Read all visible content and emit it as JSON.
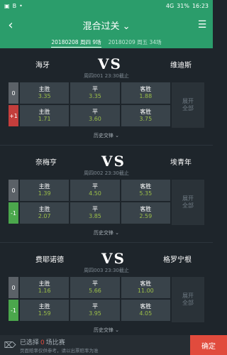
{
  "statusbar": {
    "left_icons": [
      "▣",
      "B",
      "•"
    ],
    "signal": "4G",
    "battery": "31%",
    "time": "16:23"
  },
  "header": {
    "back_icon": "‹",
    "title": "混合过关",
    "title_caret": "⌄",
    "menu_icon": "☰"
  },
  "datebar": {
    "active": "20180208 周四 9场",
    "next": "20180209 周五 34场"
  },
  "matches": [
    {
      "home": "海牙",
      "vs": "VS",
      "away": "维迪斯",
      "meta": "周四001   23:30截止",
      "rows": [
        {
          "hc": "0",
          "hc_type": "zero",
          "odds": [
            {
              "l": "主胜",
              "v": "3.35"
            },
            {
              "l": "平",
              "v": "3.35"
            },
            {
              "l": "客胜",
              "v": "1.88"
            }
          ]
        },
        {
          "hc": "+1",
          "hc_type": "pos",
          "odds": [
            {
              "l": "主胜",
              "v": "1.71"
            },
            {
              "l": "平",
              "v": "3.60"
            },
            {
              "l": "客胜",
              "v": "3.75"
            }
          ]
        }
      ],
      "expand_1": "展开",
      "expand_2": "全部",
      "history": "历史交锋 ⌄"
    },
    {
      "home": "奈梅亨",
      "vs": "VS",
      "away": "埃青年",
      "meta": "周四002   23:30截止",
      "rows": [
        {
          "hc": "0",
          "hc_type": "zero",
          "odds": [
            {
              "l": "主胜",
              "v": "1.39"
            },
            {
              "l": "平",
              "v": "4.50"
            },
            {
              "l": "客胜",
              "v": "5.35"
            }
          ]
        },
        {
          "hc": "-1",
          "hc_type": "neg",
          "odds": [
            {
              "l": "主胜",
              "v": "2.07"
            },
            {
              "l": "平",
              "v": "3.85"
            },
            {
              "l": "客胜",
              "v": "2.59"
            }
          ]
        }
      ],
      "expand_1": "展开",
      "expand_2": "全部",
      "history": "历史交锋 ⌄"
    },
    {
      "home": "费耶诺德",
      "vs": "VS",
      "away": "格罗宁根",
      "meta": "周四003   23:30截止",
      "rows": [
        {
          "hc": "0",
          "hc_type": "zero",
          "odds": [
            {
              "l": "主胜",
              "v": "1.16"
            },
            {
              "l": "平",
              "v": "5.66"
            },
            {
              "l": "客胜",
              "v": "11.00"
            }
          ]
        },
        {
          "hc": "-1",
          "hc_type": "neg",
          "odds": [
            {
              "l": "主胜",
              "v": "1.59"
            },
            {
              "l": "平",
              "v": "3.95"
            },
            {
              "l": "客胜",
              "v": "4.05"
            }
          ]
        }
      ],
      "expand_1": "展开",
      "expand_2": "全部",
      "history": "历史交锋 ⌄"
    }
  ],
  "footer": {
    "trash_icon": "⌦",
    "selected_prefix": "已选择",
    "selected_count": "0",
    "selected_suffix": "场比赛",
    "note": "页面赔率仅供参考，请以出票赔率为准",
    "confirm": "确定"
  },
  "colors": {
    "brand_green": "#2b9d6b",
    "odds_value": "#9bbe48",
    "confirm_red": "#e14b3d",
    "hc_positive": "#c43e3c",
    "hc_negative": "#4ba74c"
  }
}
